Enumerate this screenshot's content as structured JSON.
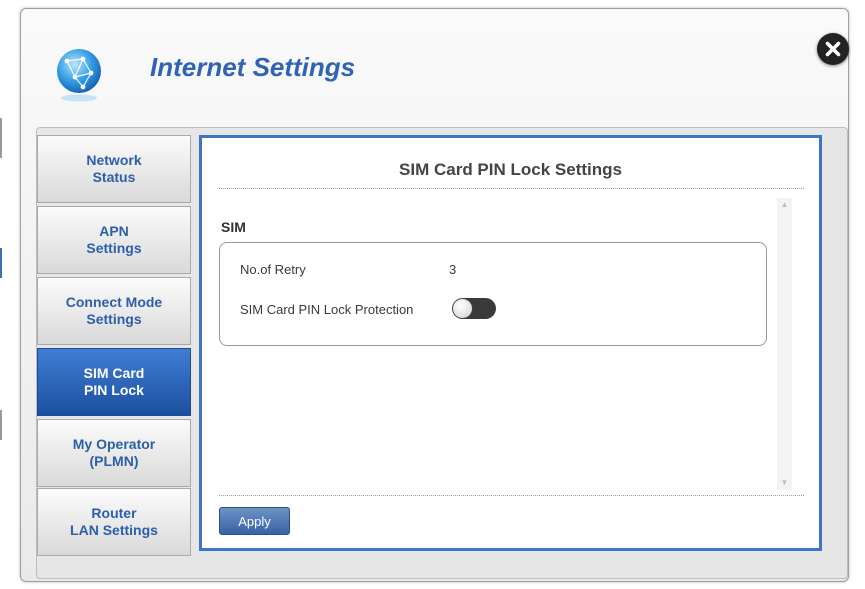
{
  "dialog": {
    "title": "Internet Settings"
  },
  "icons": {
    "header_icon": "globe-network-icon",
    "close": "close-icon",
    "scroll_up": "scroll-up-arrow-icon",
    "scroll_down": "scroll-down-arrow-icon"
  },
  "sidebar": {
    "items": [
      {
        "label": "Network\nStatus",
        "active": false
      },
      {
        "label": "APN\nSettings",
        "active": false
      },
      {
        "label": "Connect Mode\nSettings",
        "active": false
      },
      {
        "label": "SIM Card\nPIN Lock",
        "active": true
      },
      {
        "label": "My Operator\n(PLMN)",
        "active": false
      },
      {
        "label": "Router\nLAN Settings",
        "active": false
      }
    ]
  },
  "main": {
    "title": "SIM Card PIN Lock Settings",
    "section": "SIM",
    "retry_label": "No.of Retry",
    "retry_value": "3",
    "pin_lock_label": "SIM Card PIN Lock Protection",
    "pin_lock_enabled": false,
    "apply_label": "Apply"
  },
  "colors": {
    "accent": "#2f64b4",
    "active_nav": "#1c4fa0",
    "panel_border": "#3b74c8"
  }
}
